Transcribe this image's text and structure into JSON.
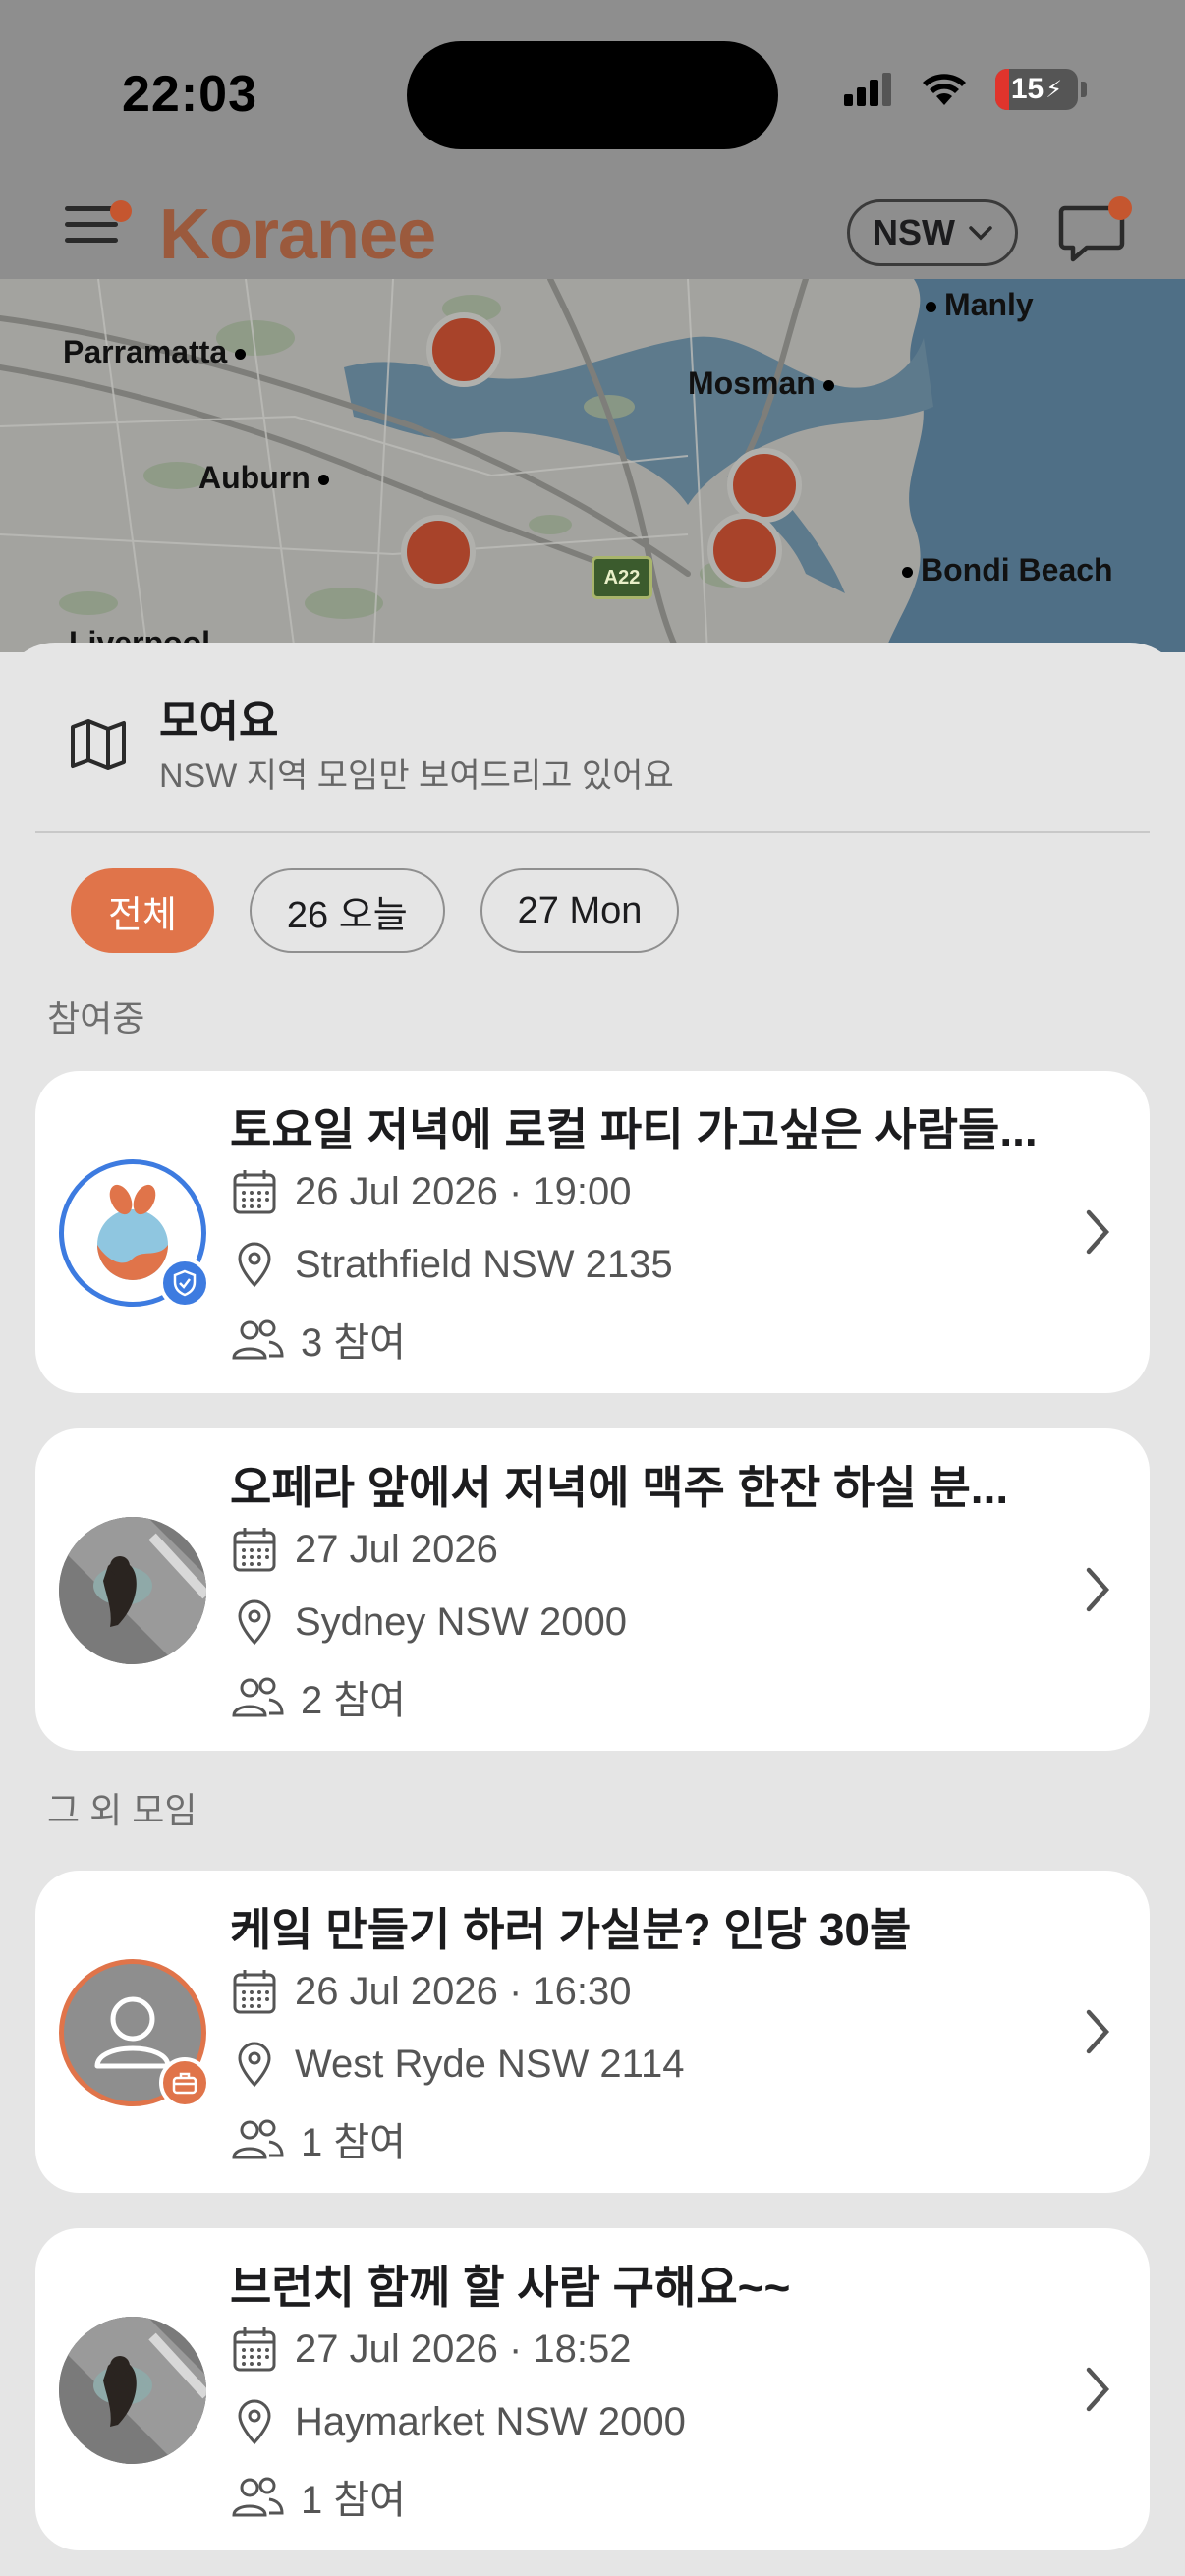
{
  "status_bar": {
    "time": "22:03",
    "battery": "15"
  },
  "header": {
    "logo": "Koranee",
    "region": "NSW"
  },
  "map": {
    "places": [
      "Parramatta",
      "Manly",
      "Mosman",
      "Auburn",
      "Bondi Beach",
      "Liverpool"
    ],
    "road_badge": "A22"
  },
  "sheet": {
    "title": "모여요",
    "subtitle": "NSW 지역 모임만 보여드리고 있어요",
    "chips": [
      "전체",
      "26 오늘",
      "27 Mon"
    ],
    "joined_label": "참여중",
    "others_label": "그 외 모임"
  },
  "meetups": [
    {
      "title": "토요일 저녁에 로컬 파티 가고싶은 사람들...",
      "datetime": "26 Jul 2026 · 19:00",
      "location": "Strathfield NSW 2135",
      "attendees": "3 참여",
      "avatar": "koranee-logo",
      "badge": "verified-shield-icon"
    },
    {
      "title": "오페라 앞에서 저녁에 맥주 한잔 하실 분...",
      "datetime": "27 Jul 2026",
      "location": "Sydney NSW 2000",
      "attendees": "2 참여",
      "avatar": "dog-photo"
    },
    {
      "title": "케잌 만들기 하러 가실분? 인당 30불",
      "datetime": "26 Jul 2026 · 16:30",
      "location": "West Ryde NSW 2114",
      "attendees": "1 참여",
      "avatar": "default-user",
      "badge": "briefcase-icon"
    },
    {
      "title": "브런치 함께 할 사람 구해요~~",
      "datetime": "27 Jul 2026 · 18:52",
      "location": "Haymarket NSW 2000",
      "attendees": "1 참여",
      "avatar": "dog-photo"
    }
  ],
  "colors": {
    "accent": "#e0744a",
    "verified": "#3d7be0",
    "marker": "#a8432a"
  }
}
